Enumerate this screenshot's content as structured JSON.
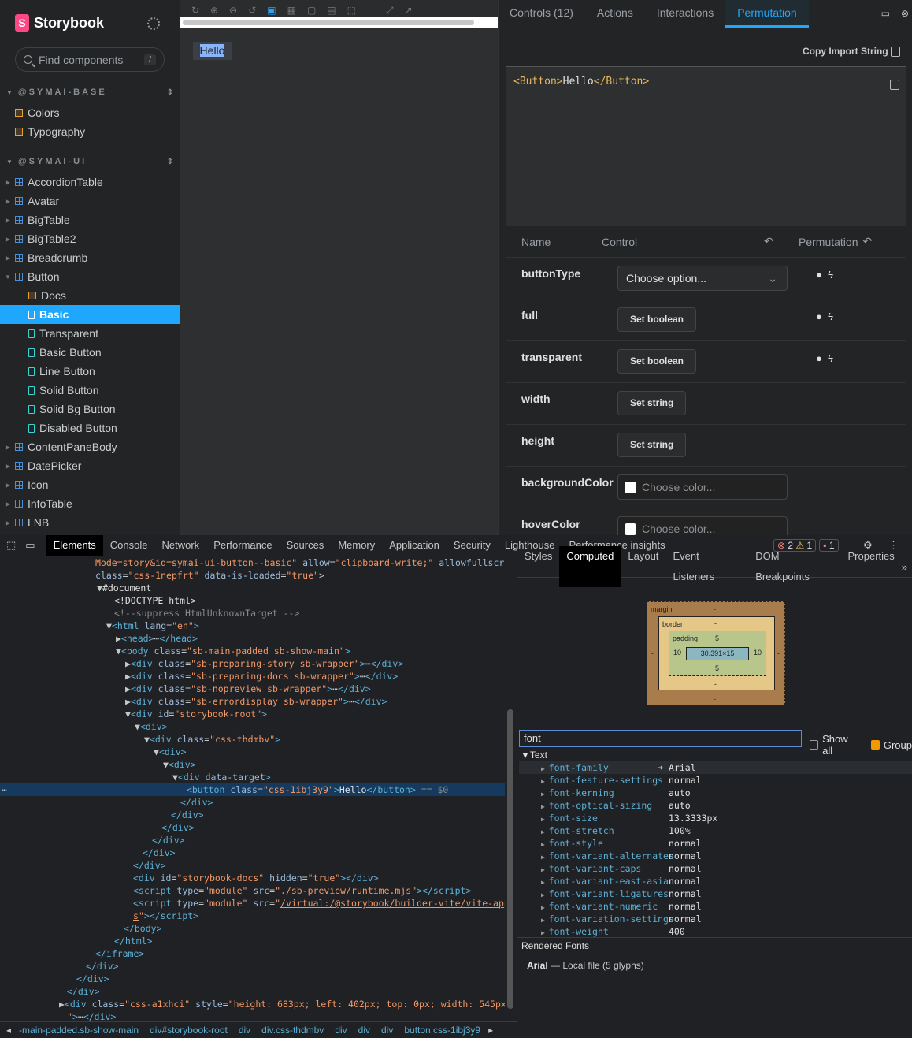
{
  "sidebar": {
    "brand": "Storybook",
    "search_placeholder": "Find components",
    "search_key": "/",
    "groups": [
      {
        "label": "@SYMAI-BASE"
      },
      {
        "label": "@SYMAI-UI"
      }
    ],
    "base_items": [
      "Colors",
      "Typography"
    ],
    "ui_items": [
      "AccordionTable",
      "Avatar",
      "BigTable",
      "BigTable2",
      "Breadcrumb",
      "Button",
      "ContentPaneBody",
      "DatePicker",
      "Icon",
      "InfoTable",
      "LNB"
    ],
    "button_children": [
      "Docs",
      "Basic",
      "Transparent",
      "Basic Button",
      "Line Button",
      "Solid Button",
      "Solid Bg Button",
      "Disabled Button"
    ]
  },
  "preview": {
    "button_text": "Hello"
  },
  "addons": {
    "tabs": [
      "Controls (12)",
      "Actions",
      "Interactions",
      "Permutation"
    ],
    "copy_import": "Copy Import String",
    "code_open": "<Button>",
    "code_text": "Hello",
    "code_close": "</Button>",
    "headers": {
      "name": "Name",
      "control": "Control",
      "permutation": "Permutation"
    },
    "rows": [
      {
        "name": "buttonType",
        "control": "Choose option..."
      },
      {
        "name": "full",
        "control": "Set boolean"
      },
      {
        "name": "transparent",
        "control": "Set boolean"
      },
      {
        "name": "width",
        "control": "Set string"
      },
      {
        "name": "height",
        "control": "Set string"
      },
      {
        "name": "backgroundColor",
        "control": "Choose color..."
      },
      {
        "name": "hoverColor",
        "control": "Choose color..."
      }
    ]
  },
  "devtools": {
    "tabs": [
      "Elements",
      "Console",
      "Network",
      "Performance",
      "Sources",
      "Memory",
      "Application",
      "Security",
      "Lighthouse",
      "Performance insights"
    ],
    "errors": "2",
    "warnings": "1",
    "issues": "1",
    "side_tabs": [
      "Styles",
      "Computed",
      "Layout",
      "Event Listeners",
      "DOM Breakpoints",
      "Properties"
    ],
    "box": {
      "margin": "margin",
      "border": "border",
      "padding": "padding",
      "dash": "-",
      "pad_top": "5",
      "pad_bottom": "5",
      "pad_left": "10",
      "pad_right": "10",
      "content": "30.391×15"
    },
    "filter_value": "font",
    "show_all": "Show all",
    "group": "Group",
    "section": "Text",
    "props": [
      {
        "k": "font-family",
        "v": "Arial"
      },
      {
        "k": "font-feature-settings",
        "v": "normal"
      },
      {
        "k": "font-kerning",
        "v": "auto"
      },
      {
        "k": "font-optical-sizing",
        "v": "auto"
      },
      {
        "k": "font-size",
        "v": "13.3333px"
      },
      {
        "k": "font-stretch",
        "v": "100%"
      },
      {
        "k": "font-style",
        "v": "normal"
      },
      {
        "k": "font-variant-alternates",
        "v": "normal"
      },
      {
        "k": "font-variant-caps",
        "v": "normal"
      },
      {
        "k": "font-variant-east-asian",
        "v": "normal"
      },
      {
        "k": "font-variant-ligatures",
        "v": "normal"
      },
      {
        "k": "font-variant-numeric",
        "v": "normal"
      },
      {
        "k": "font-variation-settings",
        "v": "normal"
      },
      {
        "k": "font-weight",
        "v": "400"
      }
    ],
    "rendered_fonts": "Rendered Fonts",
    "rendered_font_name": "Arial",
    "rendered_font_detail": "Local file (5 glyphs)",
    "breadcrumbs": [
      "-main-padded.sb-show-main",
      "div#storybook-root",
      "div",
      "div.css-thdmbv",
      "div",
      "div",
      "div",
      "button.css-1ibj3y9"
    ]
  }
}
